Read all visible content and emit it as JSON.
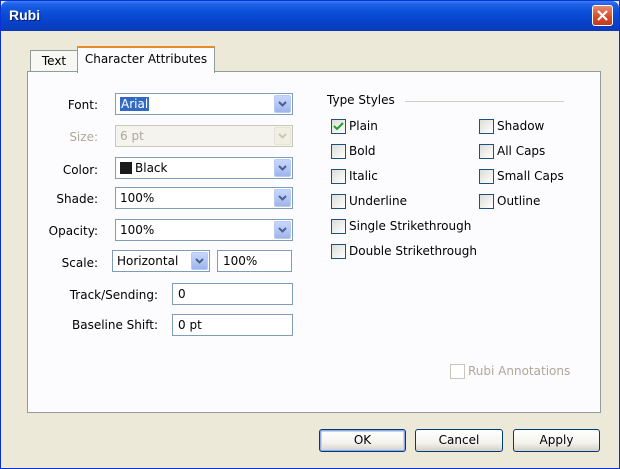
{
  "window": {
    "title": "Rubi"
  },
  "tabs": [
    "Text",
    "Character Attributes"
  ],
  "attributes": {
    "font": {
      "label": "Font:",
      "value": "Arial"
    },
    "size": {
      "label": "Size:",
      "value": "6 pt"
    },
    "color": {
      "label": "Color:",
      "value": "Black",
      "swatch": "#1a1a1a"
    },
    "shade": {
      "label": "Shade:",
      "value": "100%"
    },
    "opacity": {
      "label": "Opacity:",
      "value": "100%"
    },
    "scale": {
      "label": "Scale:",
      "direction": "Horizontal",
      "value": "100%"
    },
    "track": {
      "label": "Track/Sending:",
      "value": "0"
    },
    "baseline": {
      "label": "Baseline Shift:",
      "value": "0 pt"
    }
  },
  "type_styles": {
    "title": "Type Styles",
    "left": [
      {
        "label": "Plain",
        "checked": true
      },
      {
        "label": "Bold",
        "checked": false
      },
      {
        "label": "Italic",
        "checked": false
      },
      {
        "label": "Underline",
        "checked": false
      },
      {
        "label": "Single Strikethrough",
        "checked": false
      },
      {
        "label": "Double Strikethrough",
        "checked": false
      }
    ],
    "right": [
      {
        "label": "Shadow",
        "checked": false
      },
      {
        "label": "All Caps",
        "checked": false
      },
      {
        "label": "Small Caps",
        "checked": false
      },
      {
        "label": "Outline",
        "checked": false
      }
    ]
  },
  "rubi_annotations": {
    "label": "Rubi Annotations",
    "checked": false
  },
  "buttons": {
    "ok": "OK",
    "cancel": "Cancel",
    "apply": "Apply"
  }
}
